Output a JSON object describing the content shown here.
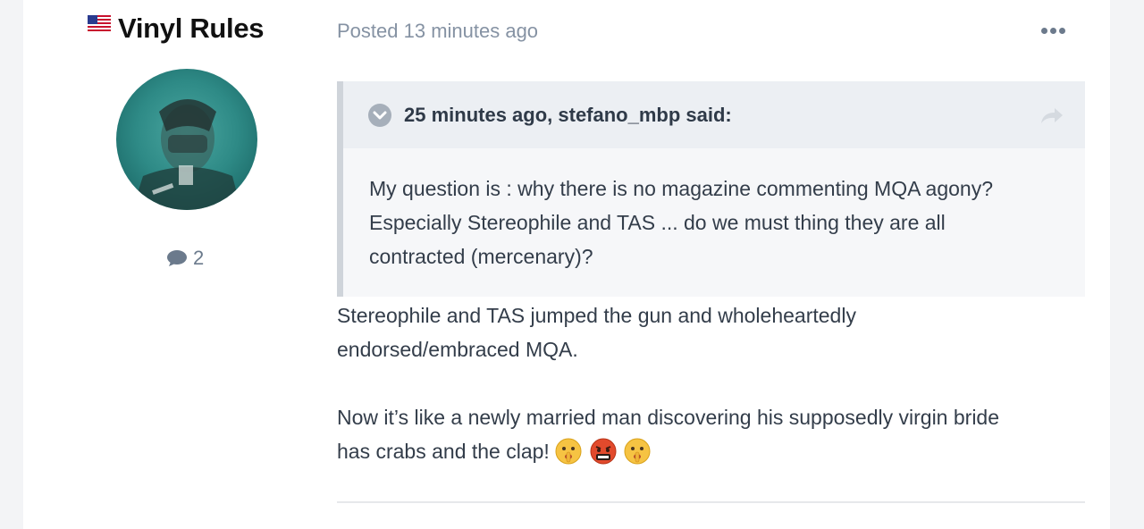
{
  "author": {
    "name": "Vinyl Rules",
    "flag_icon": "us-flag-icon",
    "post_count": "2",
    "post_count_icon": "comment-icon"
  },
  "post": {
    "posted": "Posted 13 minutes ago",
    "more_icon": "ellipsis-icon",
    "quote": {
      "cite": "25 minutes ago, stefano_mbp said:",
      "toggle_icon": "chevron-down-icon",
      "share_icon": "share-arrow-icon",
      "lines": [
        "My question is : why there is no magazine commenting MQA agony?",
        "Especially Stereophile and TAS ... do we must thing they are all",
        "contracted (mercenary)?"
      ]
    },
    "reply": {
      "p1_lines": [
        "Stereophile and TAS jumped the gun and wholeheartedly",
        "endorsed/embraced MQA."
      ],
      "p2_lines": [
        "Now it’s like a newly married man discovering his supposedly virgin bride",
        "has crabs and the clap!"
      ],
      "emojis": [
        "shushing-face-emoji",
        "cursing-face-emoji",
        "shushing-face-emoji"
      ]
    }
  },
  "colors": {
    "accent_text": "#2f3a48",
    "muted": "#8592a3",
    "quote_bg": "#f6f7f9",
    "quote_header_bg": "#eceff3"
  }
}
